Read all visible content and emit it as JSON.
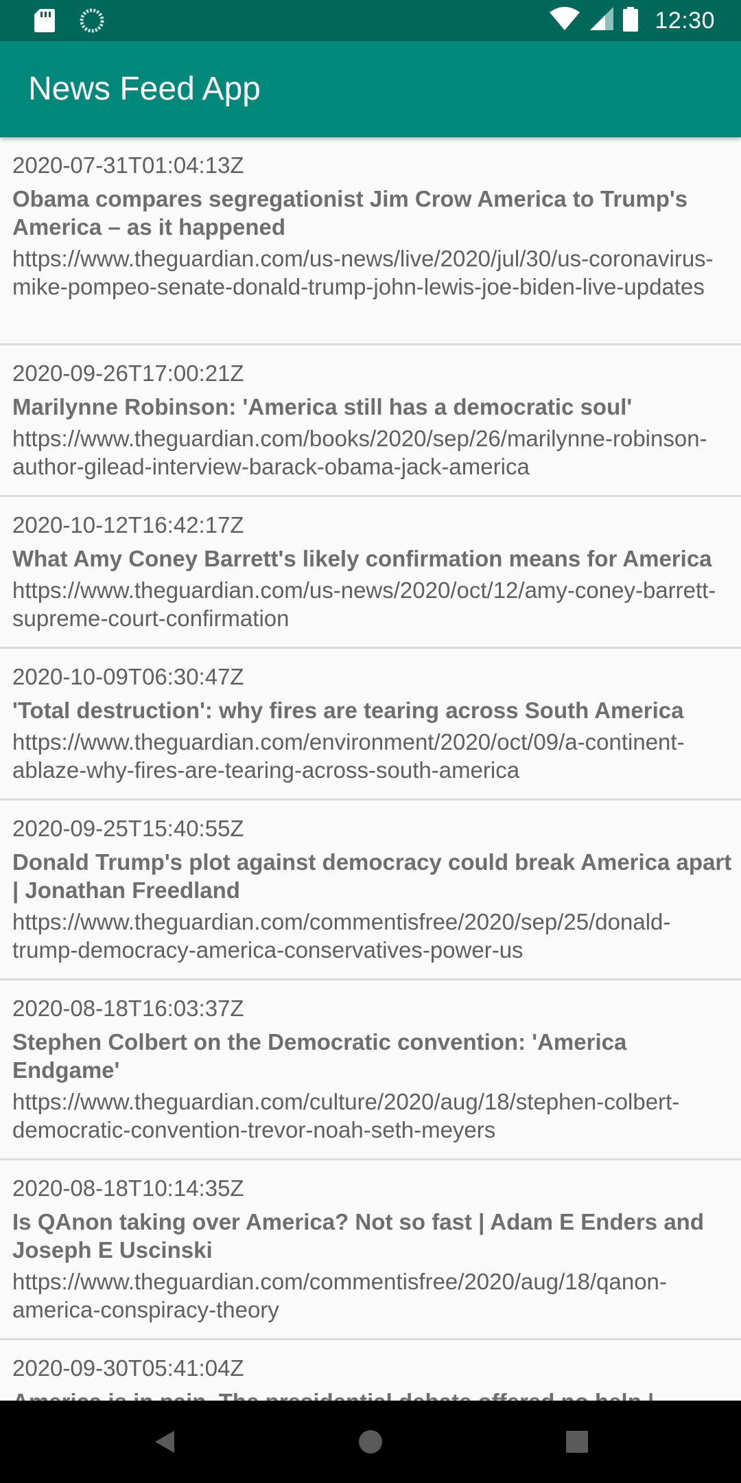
{
  "status_bar": {
    "time": "12:30",
    "icons": [
      "sd-card-icon",
      "sync-icon",
      "wifi-icon",
      "signal-icon",
      "battery-icon"
    ]
  },
  "app_bar": {
    "title": "News Feed App",
    "color": "#00897b",
    "status_color": "#00675b"
  },
  "articles": [
    {
      "date": "2020-07-31T01:04:13Z",
      "title": "Obama compares segregationist Jim Crow America to Trump's America – as it happened",
      "url": "https://www.theguardian.com/us-news/live/2020/jul/30/us-coronavirus-mike-pompeo-senate-donald-trump-john-lewis-joe-biden-live-updates"
    },
    {
      "date": "2020-09-26T17:00:21Z",
      "title": "Marilynne Robinson: 'America still has a democratic soul'",
      "url": "https://www.theguardian.com/books/2020/sep/26/marilynne-robinson-author-gilead-interview-barack-obama-jack-america"
    },
    {
      "date": "2020-10-12T16:42:17Z",
      "title": "What Amy Coney Barrett's likely confirmation means for America",
      "url": "https://www.theguardian.com/us-news/2020/oct/12/amy-coney-barrett-supreme-court-confirmation"
    },
    {
      "date": "2020-10-09T06:30:47Z",
      "title": "'Total destruction': why fires are tearing across South America",
      "url": "https://www.theguardian.com/environment/2020/oct/09/a-continent-ablaze-why-fires-are-tearing-across-south-america"
    },
    {
      "date": "2020-09-25T15:40:55Z",
      "title": "Donald Trump's plot against democracy could break America apart | Jonathan Freedland",
      "url": "https://www.theguardian.com/commentisfree/2020/sep/25/donald-trump-democracy-america-conservatives-power-us"
    },
    {
      "date": "2020-08-18T16:03:37Z",
      "title": "Stephen Colbert on the Democratic convention: 'America Endgame'",
      "url": "https://www.theguardian.com/culture/2020/aug/18/stephen-colbert-democratic-convention-trevor-noah-seth-meyers"
    },
    {
      "date": "2020-08-18T10:14:35Z",
      "title": "Is QAnon taking over America? Not so fast | Adam E Enders and Joseph E Uscinski",
      "url": "https://www.theguardian.com/commentisfree/2020/aug/18/qanon-america-conspiracy-theory"
    },
    {
      "date": "2020-09-30T05:41:04Z",
      "title": "America is in pain. The presidential debate offered no help |",
      "url": ""
    }
  ],
  "nav_bar": {
    "icons": [
      "back-icon",
      "home-icon",
      "recents-icon"
    ]
  }
}
